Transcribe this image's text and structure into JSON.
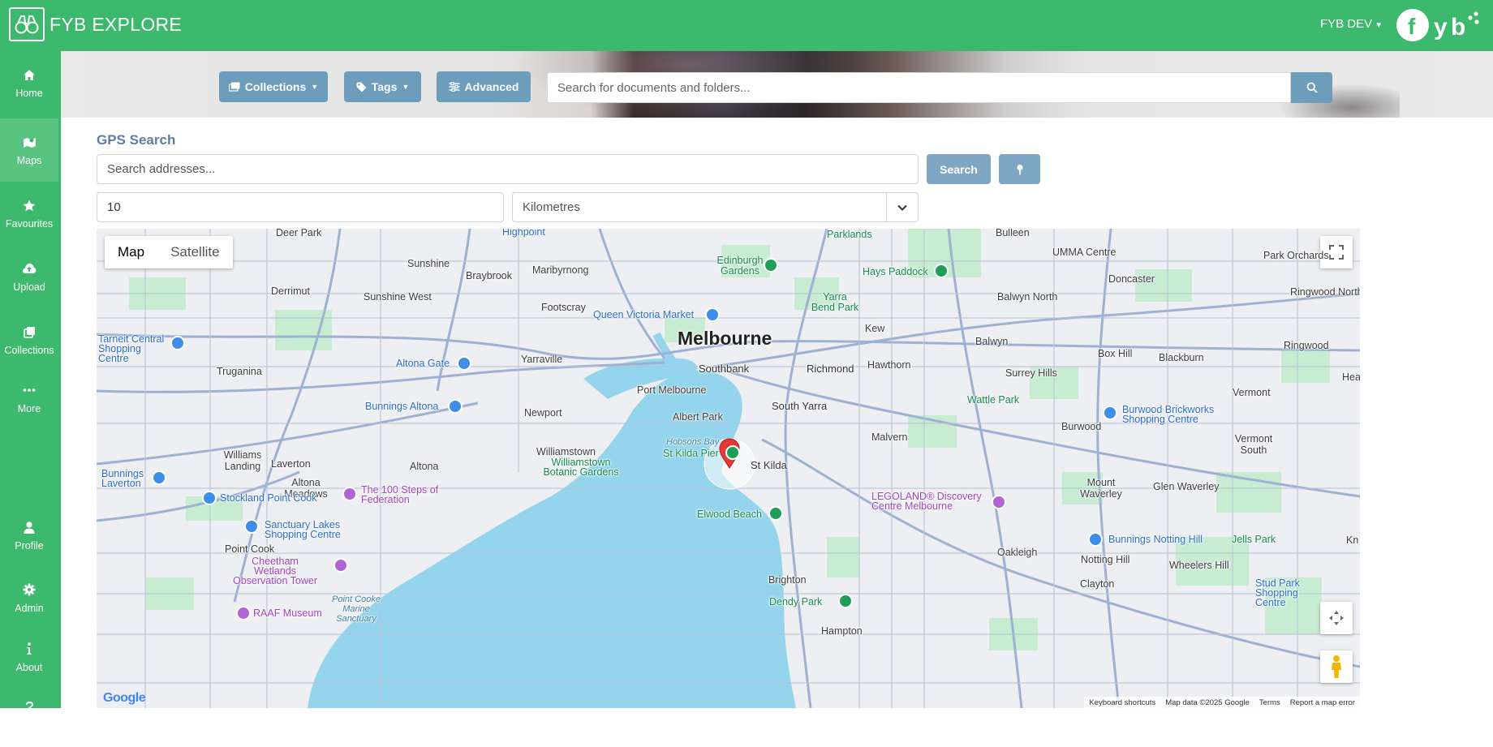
{
  "app": {
    "brand": "FYB EXPLORE",
    "user": "FYB DEV"
  },
  "sidebar": {
    "items": [
      {
        "label": "Home",
        "icon": "home-icon"
      },
      {
        "label": "Maps",
        "icon": "map-icon",
        "active": true
      },
      {
        "label": "Favourites",
        "icon": "star-icon"
      },
      {
        "label": "Upload",
        "icon": "cloud-upload-icon"
      },
      {
        "label": "Collections",
        "icon": "collections-icon"
      },
      {
        "label": "More",
        "icon": "ellipsis-icon"
      },
      {
        "label": "Profile",
        "icon": "user-icon"
      },
      {
        "label": "Admin",
        "icon": "gear-icon"
      },
      {
        "label": "About",
        "icon": "info-icon"
      },
      {
        "label": "Help",
        "icon": "question-icon"
      }
    ]
  },
  "toolbar": {
    "collections_label": "Collections",
    "tags_label": "Tags",
    "advanced_label": "Advanced",
    "search_placeholder": "Search for documents and folders..."
  },
  "gps": {
    "title": "GPS Search",
    "address_placeholder": "Search addresses...",
    "search_label": "Search",
    "radius_value": "10",
    "unit_value": "Kilometres"
  },
  "map": {
    "type_map": "Map",
    "type_satellite": "Satellite",
    "google_logo": "Google",
    "footer": {
      "keyboard": "Keyboard shortcuts",
      "data": "Map data ©2025 Google",
      "terms": "Terms",
      "report": "Report a map error"
    },
    "city": "Melbourne",
    "suburbs": [
      "Deer Park",
      "Sunshine",
      "Braybrook",
      "Maribyrnong",
      "Derrimut",
      "Sunshine West",
      "Footscray",
      "Truganina",
      "Yarraville",
      "Southbank",
      "Richmond",
      "Hawthorn",
      "Kew",
      "Balwyn",
      "Balwyn North",
      "Doncaster",
      "Surrey Hills",
      "Box Hill",
      "Blackburn",
      "Ringwood",
      "Ringwood North",
      "Park Orchards",
      "Bulleen",
      "Port Melbourne",
      "Albert Park",
      "South Yarra",
      "Malvern",
      "Newport",
      "Williamstown",
      "Williams Landing",
      "Laverton",
      "Altona",
      "Altona Meadows",
      "St Kilda",
      "Burwood",
      "Vermont",
      "Vermont South",
      "Mount Waverley",
      "Glen Waverley",
      "Oakleigh",
      "Notting Hill",
      "Wheelers Hill",
      "Clayton",
      "Point Cook",
      "Brighton",
      "Hampton",
      "Heat",
      "Kn"
    ],
    "places": [
      "Highpoint",
      "Edinburgh Gardens",
      "Parklands",
      "UMMA Centre",
      "Hays Paddock",
      "Yarra Bend Park",
      "Queen Victoria Market",
      "Altona Gate",
      "Bunnings Altona",
      "Wattle Park",
      "Burwood Brickworks Shopping Centre",
      "Hobsons Bay",
      "St Kilda Pier",
      "Williamstown Botanic Gardens",
      "Bunnings Laverton",
      "Stockland Point Cook",
      "The 100 Steps of Federation",
      "Sanctuary Lakes Shopping Centre",
      "LEGOLAND® Discovery Centre Melbourne",
      "Elwood Beach",
      "Bunnings Notting Hill",
      "Jells Park",
      "Cheetham Wetlands Observation Tower",
      "Point Cooke Marine Sanctuary",
      "RAAF Museum",
      "Dendy Park",
      "Stud Park Shopping Centre",
      "Tarneit Central Shopping Centre"
    ]
  }
}
